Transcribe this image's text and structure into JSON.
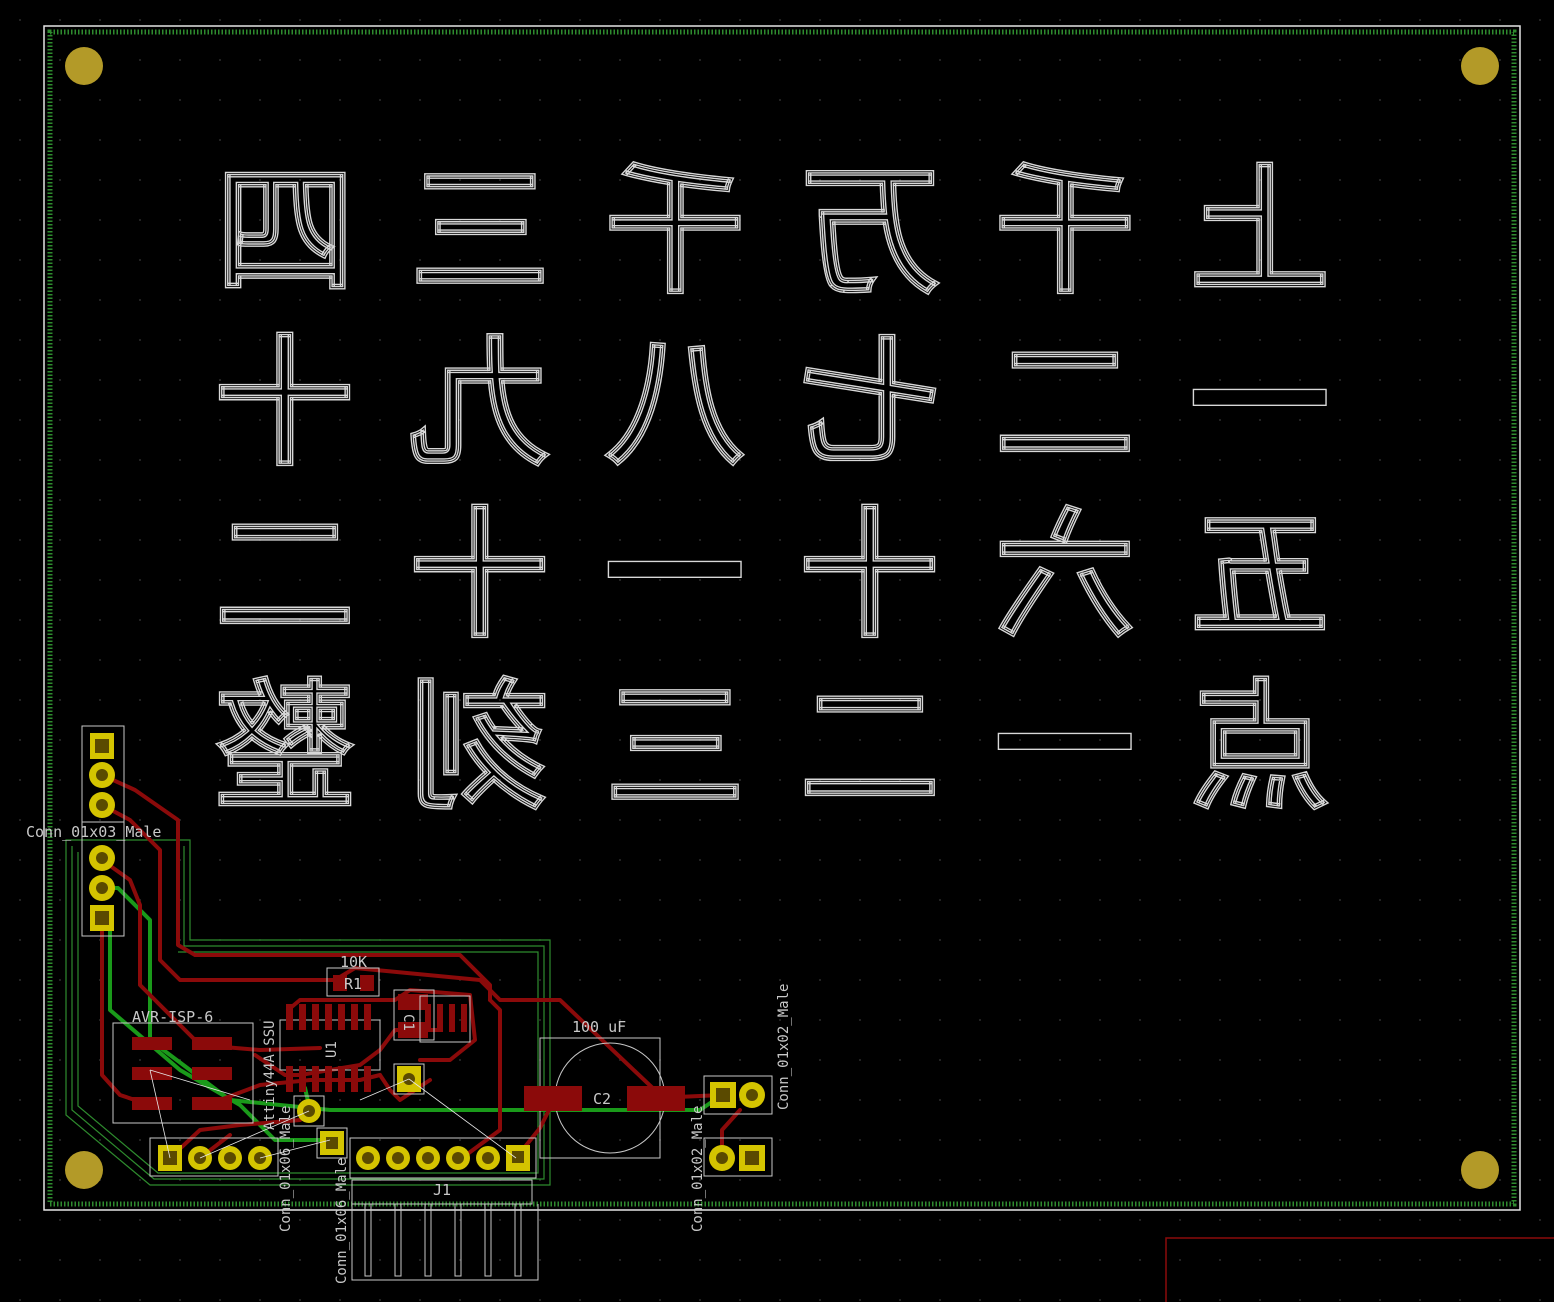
{
  "board": {
    "outline_color": "#e6e6e6",
    "edge_color": "#2e8b2e",
    "pad_color": "#d4c400",
    "copper_front_color": "#8b0a0a",
    "copper_back_color": "#1a9a1a",
    "silkscreen_color": "#c8c8c8"
  },
  "artwork_text": {
    "rows": [
      [
        "四",
        "三",
        "千",
        "万",
        "千",
        "上"
      ],
      [
        "十",
        "九",
        "八",
        "七",
        "二",
        "一"
      ],
      [
        "二",
        "十",
        "一",
        "十",
        "六",
        "五"
      ],
      [
        "整",
        "刻",
        "三",
        "二",
        "一",
        "点"
      ]
    ]
  },
  "labels": {
    "conn_01x03": "Conn_01x03_Male",
    "avr_isp": "AVR-ISP-6",
    "r1_value": "10K",
    "r1_ref": "R1",
    "c1_ref": "C1",
    "u1_ref": "U1",
    "u1_value": "Attiny44A-SSU",
    "c2_value": "100 uF",
    "c2_ref": "C2",
    "j1_ref": "J1",
    "conn_01x06": "Conn_01x06_Male",
    "conn_01x02_a": "Conn_01x02_Male",
    "conn_01x02_b": "Conn_01x02_Male"
  }
}
